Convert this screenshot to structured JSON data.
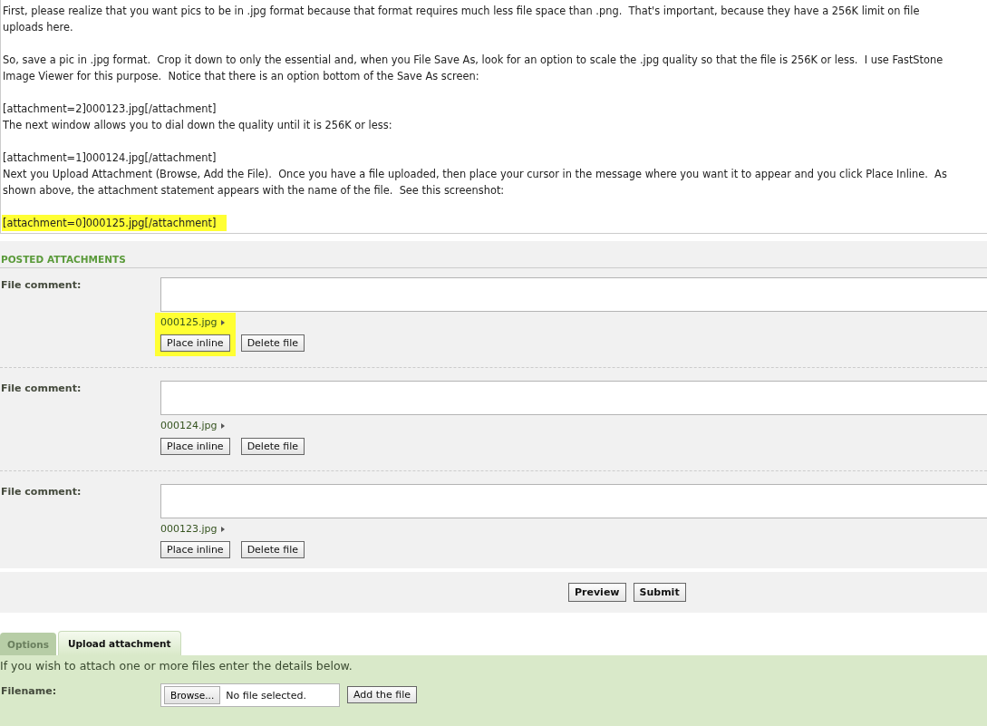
{
  "message": {
    "paragraphs": [
      {
        "highlighted": false,
        "lines": [
          "First, please realize that you want pics to be in .jpg format because that format requires much less file space than .png.  That's important, because they have a 256K limit on file",
          "uploads here."
        ]
      },
      {
        "highlighted": false,
        "lines": [
          "So, save a pic in .jpg format.  Crop it down to only the essential and, when you File Save As, look for an option to scale the .jpg quality so that the file is 256K or less.  I use FastStone",
          "Image Viewer for this purpose.  Notice that there is an option bottom of the Save As screen:"
        ]
      },
      {
        "highlighted": false,
        "lines": [
          "[attachment=2]000123.jpg[/attachment]",
          "The next window allows you to dial down the quality until it is 256K or less:"
        ]
      },
      {
        "highlighted": false,
        "lines": [
          "[attachment=1]000124.jpg[/attachment]",
          "Next you Upload Attachment (Browse, Add the File).  Once you have a file uploaded, then place your cursor in the message where you want it to appear and you click Place Inline.  As",
          "shown above, the attachment statement appears with the name of the file.  See this screenshot:"
        ]
      },
      {
        "highlighted": true,
        "lines": [
          "[attachment=0]000125.jpg[/attachment]"
        ]
      }
    ]
  },
  "posted_attachments": {
    "title": "POSTED ATTACHMENTS",
    "items": [
      {
        "label": "File comment:",
        "filename": "000125.jpg",
        "highlighted": true,
        "place_button": "Place inline",
        "delete_button": "Delete file"
      },
      {
        "label": "File comment:",
        "filename": "000124.jpg",
        "highlighted": false,
        "place_button": "Place inline",
        "delete_button": "Delete file"
      },
      {
        "label": "File comment:",
        "filename": "000123.jpg",
        "highlighted": false,
        "place_button": "Place inline",
        "delete_button": "Delete file"
      }
    ]
  },
  "actions": [
    "Preview",
    "Submit"
  ],
  "tabs": [
    {
      "label": "Options",
      "selected": false
    },
    {
      "label": "Upload attachment",
      "selected": true
    }
  ],
  "upload": {
    "intro": "If you wish to attach one or more files enter the details below.",
    "label": "Filename:",
    "browse_button": "Browse...",
    "file_status": "No file selected.",
    "add_button": "Add the file"
  }
}
